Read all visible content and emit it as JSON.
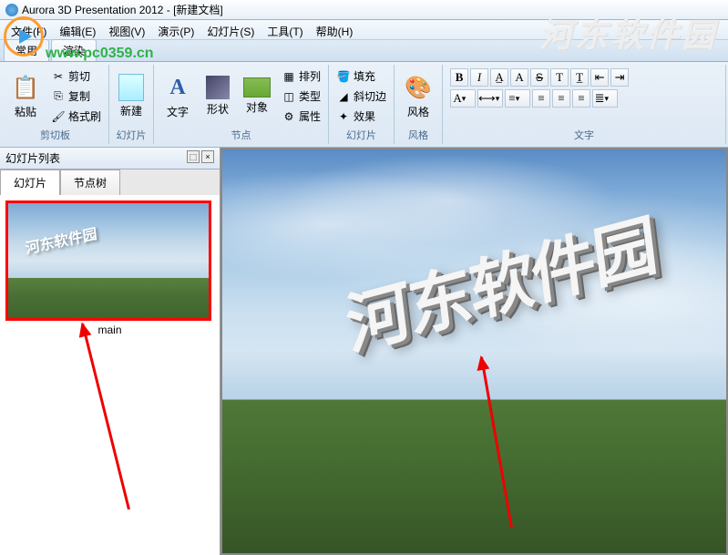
{
  "title": "Aurora 3D Presentation 2012 - [新建文档]",
  "watermark_url": "www.pc0359.cn",
  "watermark_side": "河东软件园",
  "menu": {
    "file": "文件(F)",
    "edit": "编辑(E)",
    "view": "视图(V)",
    "present": "演示(P)",
    "slide": "幻灯片(S)",
    "tools": "工具(T)",
    "help": "帮助(H)"
  },
  "tabs": {
    "common": "常用",
    "render": "渲染"
  },
  "ribbon": {
    "clipboard": {
      "label": "剪切板",
      "paste": "粘贴",
      "cut": "剪切",
      "copy": "复制",
      "fmt": "格式刷"
    },
    "slides": {
      "label": "幻灯片",
      "new": "新建"
    },
    "nodes": {
      "label": "节点",
      "text": "文字",
      "shape": "形状",
      "object": "对象",
      "arrange": "排列",
      "type": "类型",
      "props": "属性"
    },
    "slideview": {
      "label": "幻灯片",
      "fill": "填充",
      "bevel": "斜切边",
      "effect": "效果"
    },
    "style": {
      "label": "风格",
      "btn": "风格"
    },
    "textfmt": {
      "label": "文字"
    }
  },
  "sidepanel": {
    "title": "幻灯片列表",
    "tab1": "幻灯片",
    "tab2": "节点树",
    "thumb_label": "main",
    "thumb_text": "河东软件园"
  },
  "scene_text": "河东软件园"
}
